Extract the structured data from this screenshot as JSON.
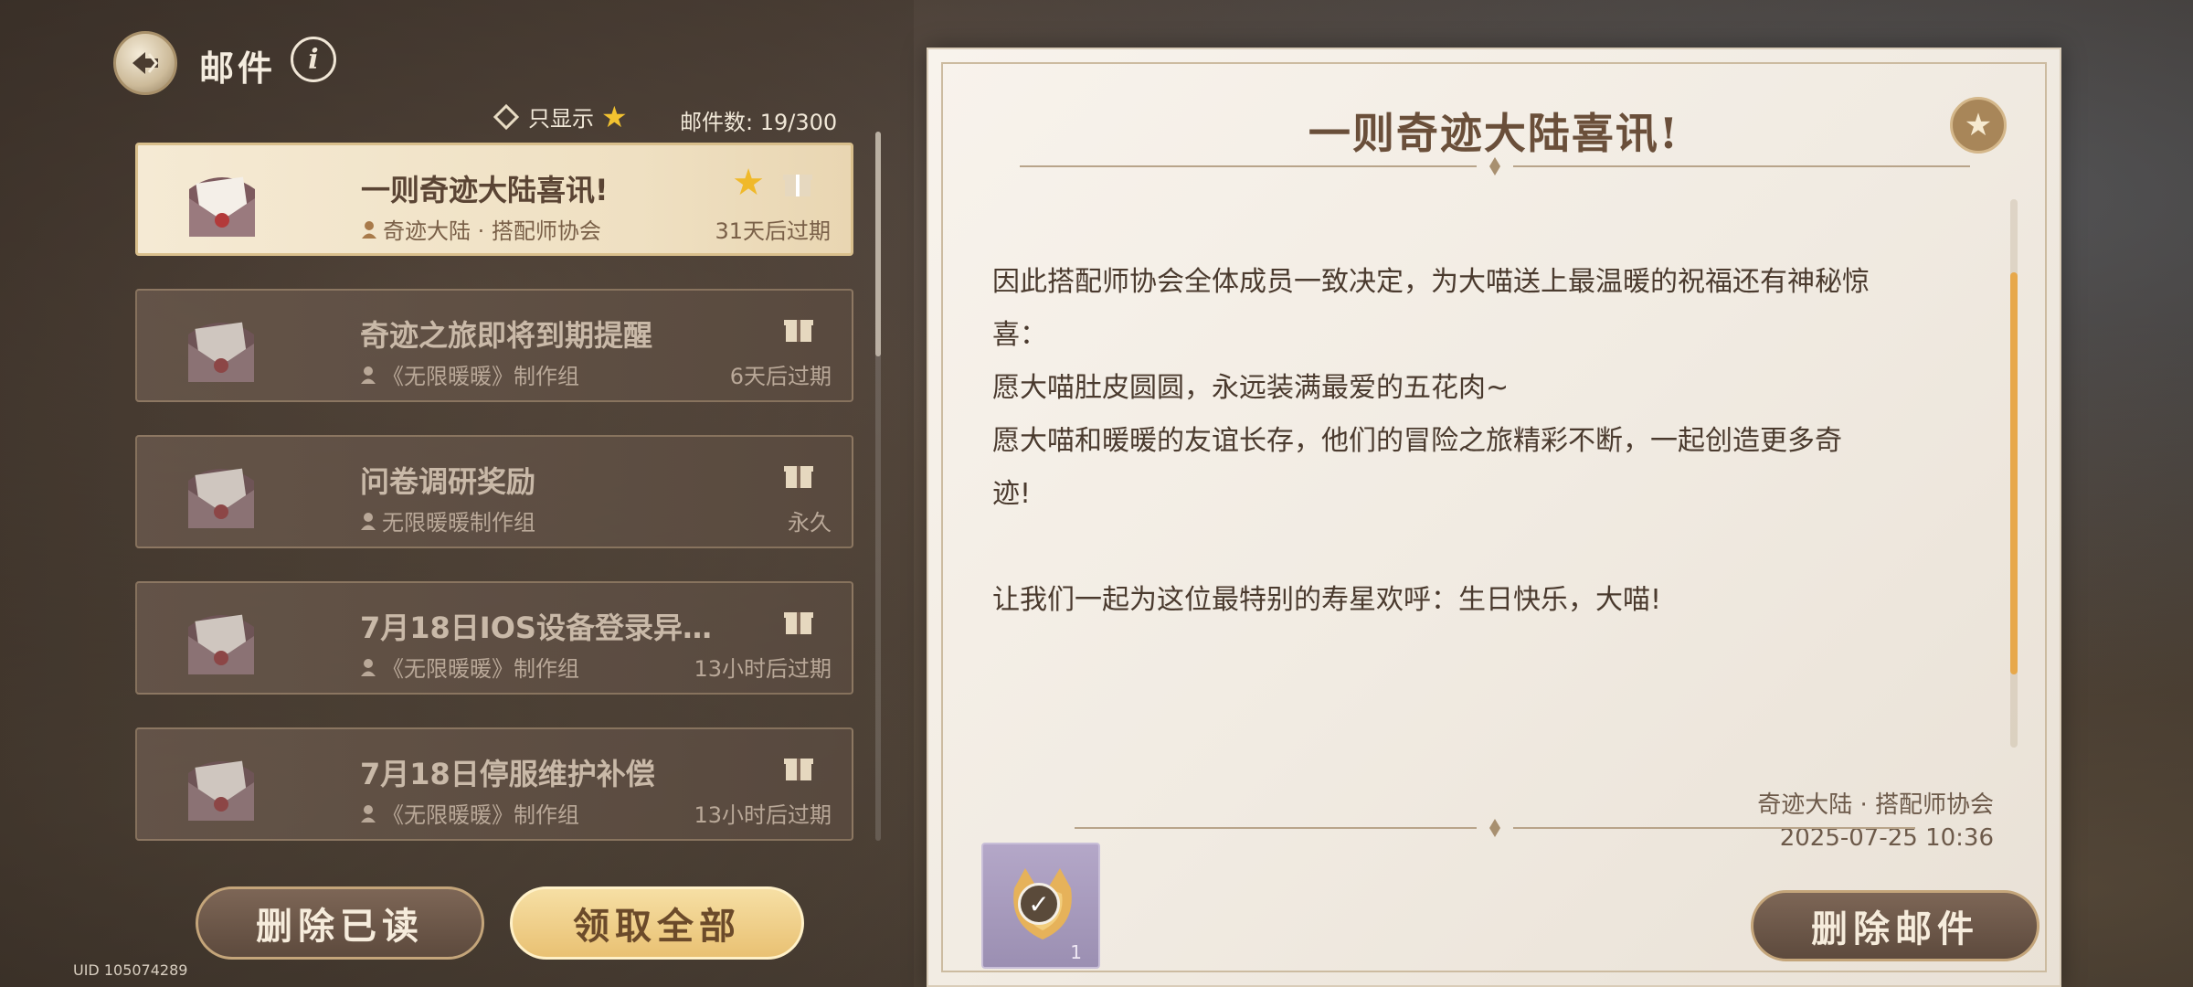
{
  "header": {
    "title": "邮件",
    "filter_label": "只显示",
    "mail_count_label": "邮件数:",
    "mail_count": "19/300"
  },
  "mails": [
    {
      "title": "一则奇迹大陆喜讯!",
      "sender": "奇迹大陆 · 搭配师协会",
      "expiry": "31天后过期",
      "selected": true
    },
    {
      "title": "奇迹之旅即将到期提醒",
      "sender": "《无限暖暖》制作组",
      "expiry": "6天后过期",
      "selected": false
    },
    {
      "title": "问卷调研奖励",
      "sender": "无限暖暖制作组",
      "expiry": "永久",
      "selected": false
    },
    {
      "title": "7月18日IOS设备登录异…",
      "sender": "《无限暖暖》制作组",
      "expiry": "13小时后过期",
      "selected": false
    },
    {
      "title": "7月18日停服维护补偿",
      "sender": "《无限暖暖》制作组",
      "expiry": "13小时后过期",
      "selected": false
    }
  ],
  "buttons": {
    "delete_read": "删除已读",
    "claim_all": "领取全部",
    "delete_mail": "删除邮件"
  },
  "uid": "UID 105074289",
  "letter": {
    "title": "一则奇迹大陆喜讯!",
    "body": [
      "因此搭配师协会全体成员一致决定，为大喵送上最温暖的祝福还有神秘惊",
      "喜：",
      "愿大喵肚皮圆圆，永远装满最爱的五花肉~",
      "愿大喵和暖暖的友谊长存，他们的冒险之旅精彩不断，一起创造更多奇",
      "迹!",
      "",
      "让我们一起为这位最特别的寿星欢呼：生日快乐，大喵!"
    ],
    "sender": "奇迹大陆 · 搭配师协会",
    "date": "2025-07-25 10:36",
    "attachment_count": "1"
  },
  "colors": {
    "accent_gold": "#f2c230",
    "selected_bg": "#f5ead4",
    "scroll_thumb": "#e7a84b"
  },
  "icons": {
    "back": "back-arrow-icon",
    "info": "info-icon",
    "star": "star-icon",
    "gift": "gift-icon",
    "envelope": "envelope-icon",
    "person": "person-icon"
  }
}
